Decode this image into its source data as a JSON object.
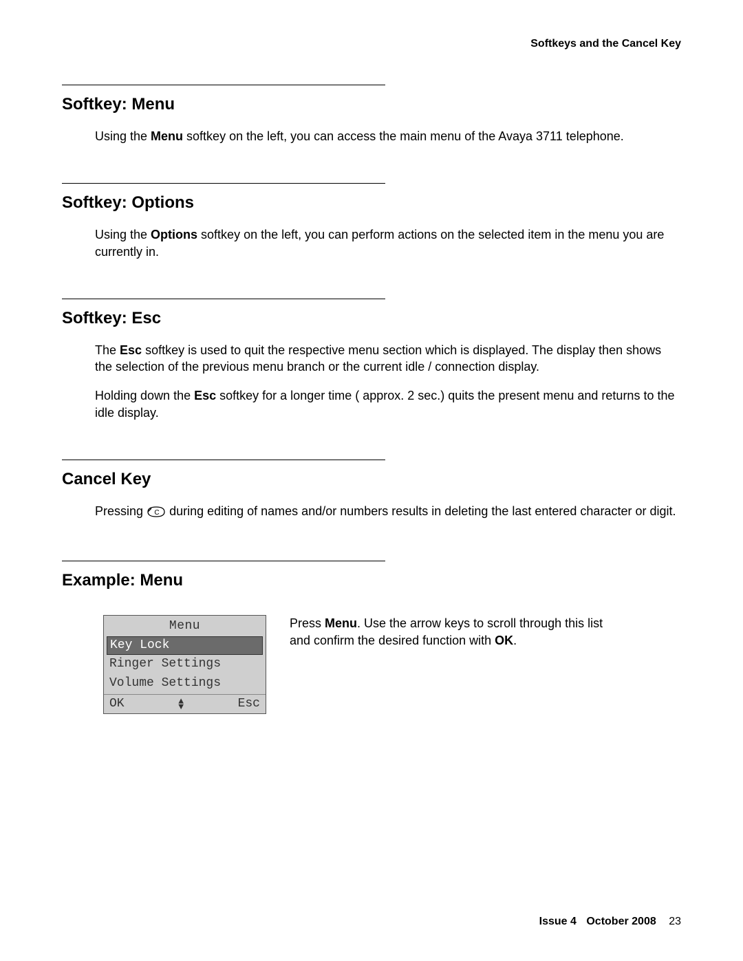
{
  "running_head": "Softkeys and the Cancel Key",
  "sections": {
    "menu": {
      "title": "Softkey: Menu",
      "para1_pre": "Using the ",
      "para1_bold": "Menu",
      "para1_post": " softkey on the left, you can access the main menu of the Avaya 3711 telephone."
    },
    "options": {
      "title": "Softkey: Options",
      "para1_pre": "Using the ",
      "para1_bold": "Options",
      "para1_post": " softkey on the left, you can perform actions on the selected item in the menu you are currently in."
    },
    "esc": {
      "title": "Softkey: Esc",
      "para1_pre": "The ",
      "para1_bold": "Esc",
      "para1_post": " softkey is used to quit the respective menu section which is displayed. The display then shows the selection of the previous menu branch or the current idle / connection display.",
      "para2_pre": "Holding down the ",
      "para2_bold": "Esc",
      "para2_post": " softkey for a longer time ( approx. 2 sec.) quits the present menu and returns to the idle display."
    },
    "cancel": {
      "title": "Cancel Key",
      "para1_pre": "Pressing ",
      "para1_post": " during editing of names and/or numbers results in deleting the last entered character or digit."
    },
    "example": {
      "title": "Example: Menu",
      "text_pre": "Press ",
      "text_bold1": "Menu",
      "text_mid": ". Use the arrow keys to scroll through this list and confirm the desired function with ",
      "text_bold2": "OK",
      "text_post": "."
    }
  },
  "phone_screen": {
    "title": "Menu",
    "items": [
      "Key Lock",
      "Ringer Settings",
      "Volume Settings"
    ],
    "selected_index": 0,
    "soft_left": "OK",
    "soft_right": "Esc"
  },
  "footer": {
    "issue": "Issue 4",
    "date": "October 2008",
    "page": "23"
  }
}
